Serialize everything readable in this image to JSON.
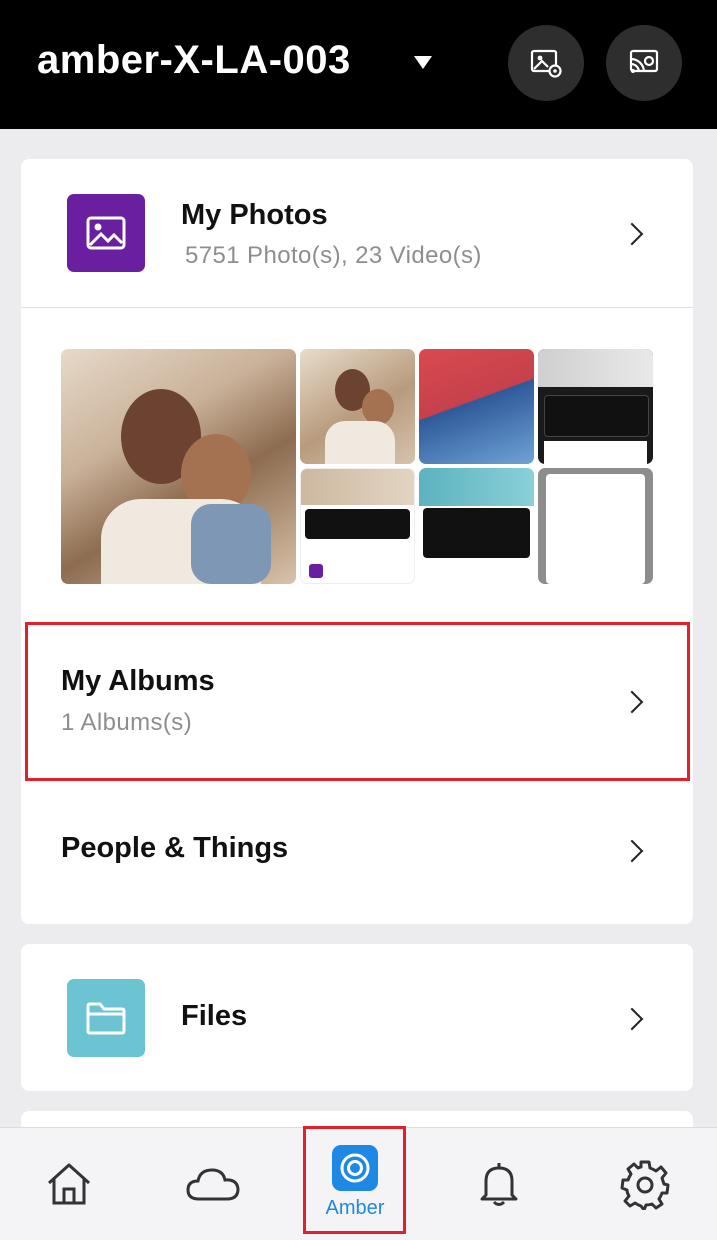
{
  "header": {
    "device_name": "amber-X-LA-003",
    "dropdown_icon": "caret-down-icon",
    "actions": [
      {
        "name": "photo-settings-icon"
      },
      {
        "name": "cast-icon"
      }
    ]
  },
  "photos_card": {
    "title": "My Photos",
    "subtitle": "5751 Photo(s), 23 Video(s)",
    "icon": "image-icon",
    "icon_color": "#6A1FA1"
  },
  "albums": {
    "title": "My Albums",
    "subtitle": "1 Albums(s)"
  },
  "people": {
    "title": "People & Things"
  },
  "files_card": {
    "title": "Files",
    "icon": "folder-icon",
    "icon_color": "#6CC3D2"
  },
  "bottom_nav": {
    "items": [
      {
        "name": "home-icon"
      },
      {
        "name": "cloud-icon"
      },
      {
        "name": "amber-icon",
        "label": "Amber"
      },
      {
        "name": "bell-icon"
      },
      {
        "name": "gear-icon"
      }
    ],
    "active_color": "#1E88E5"
  },
  "highlight_color": "#E0202A"
}
